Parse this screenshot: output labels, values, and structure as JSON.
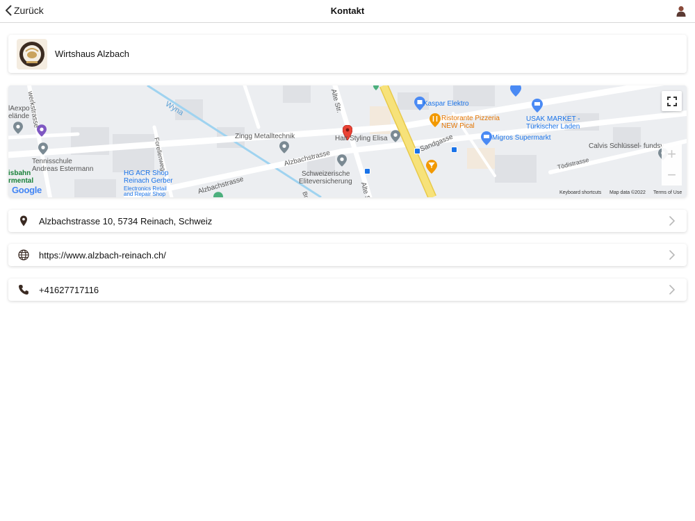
{
  "navbar": {
    "back_label": "Zurück",
    "title": "Kontakt"
  },
  "business": {
    "name": "Wirtshaus Alzbach"
  },
  "map": {
    "labels": {
      "kaspar": "Kaspar Elektro",
      "pizzeria": "Ristorante Pizzeria",
      "pizzeria2": "NEW Pical",
      "usak": "USAK MARKET -",
      "usak2": "Türkischer Laden",
      "migros": "Migros Supermarkt",
      "calvis": "Calvis Schlüssel- fundsv",
      "zingg": "Zingg Metalltechnik",
      "hair": "Hair Styling Elisa",
      "schweiz1": "Schweizerische",
      "schweiz2": "Eliteversicherung",
      "hgacr1": "HG ACR Shop",
      "hgacr2": "Reinach Gerber",
      "hgacr3": "Electronics Retail",
      "hgacr4": "and Repair Shop",
      "tennis1": "Tennisschule",
      "tennis2": "Andreas Estermann",
      "expo1": "lAexpo",
      "expo2": "elände",
      "bahn1": "isbahn",
      "bahn2": "rmental",
      "wyna": "Wyna",
      "alzbach1": "Alzbachstrasse",
      "alzbach2": "Alzbachstrasse",
      "sandgasse": "Sandgasse",
      "alte1": "Alte Str.",
      "alte2": "Alte Str",
      "werk": "werkstrasse",
      "forellen": "Forellenweg",
      "todi": "Tödistrasse",
      "brei": "Brei"
    },
    "google": "Google",
    "footer": {
      "shortcuts": "Keyboard shortcuts",
      "mapdata": "Map data ©2022",
      "terms": "Terms of Use"
    },
    "zoom_in": "+",
    "zoom_out": "−"
  },
  "contact": {
    "address": "Alzbachstrasse 10, 5734 Reinach, Schweiz",
    "website": "https://www.alzbach-reinach.ch/",
    "phone": "+41627717116"
  },
  "colors": {
    "accent": "#1a73e8",
    "icon": "#3a2a22",
    "major_road": "#f7e27a",
    "pin_red": "#ea4335"
  }
}
